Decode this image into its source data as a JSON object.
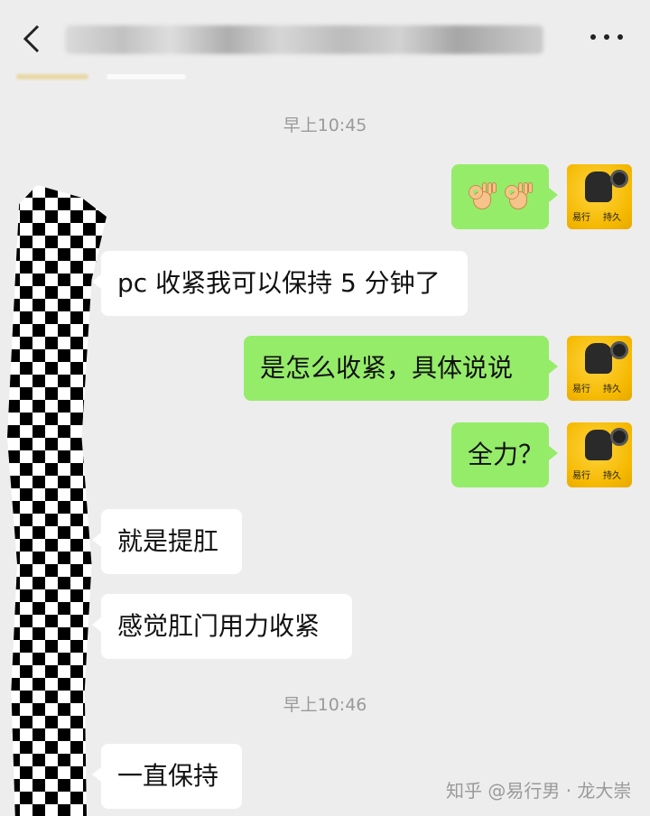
{
  "header": {
    "back_icon": "chevron-left-icon",
    "title": "",
    "more_icon": "more-dots-icon"
  },
  "timestamps": [
    "早上10:45",
    "早上10:46"
  ],
  "messages": [
    {
      "side": "right",
      "text": "",
      "emoji": [
        "ok-hand",
        "ok-hand"
      ]
    },
    {
      "side": "left",
      "text": "pc 收紧我可以保持 5 分钟了"
    },
    {
      "side": "right",
      "text": "是怎么收紧，具体说说"
    },
    {
      "side": "right",
      "text": "全力？"
    },
    {
      "side": "left",
      "text": "就是提肛"
    },
    {
      "side": "left",
      "text": "感觉肛门用力收紧"
    },
    {
      "side": "left",
      "text": "一直保持"
    }
  ],
  "avatar": {
    "label_left": "易行",
    "label_right": "持久"
  },
  "watermark": "知乎 @易行男 · 龙大崇",
  "colors": {
    "background": "#ededed",
    "bubble_mine": "#95ec69",
    "bubble_theirs": "#ffffff",
    "avatar": "#f5b800"
  }
}
